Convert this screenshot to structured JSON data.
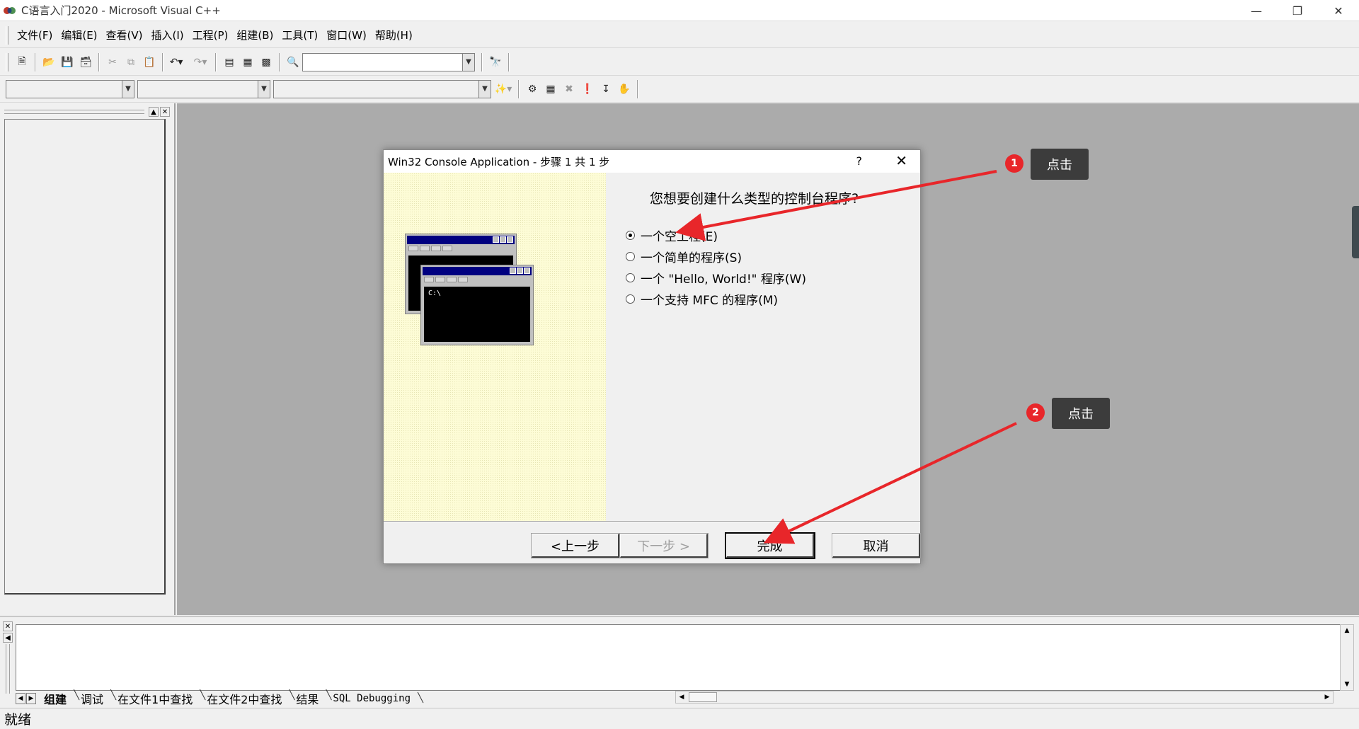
{
  "window": {
    "title": "C语言入门2020 - Microsoft Visual C++",
    "minimize_icon": "minimize-icon",
    "restore_icon": "restore-icon",
    "close_icon": "close-icon"
  },
  "menu": {
    "items": [
      "文件(F)",
      "编辑(E)",
      "查看(V)",
      "插入(I)",
      "工程(P)",
      "组建(B)",
      "工具(T)",
      "窗口(W)",
      "帮助(H)"
    ]
  },
  "toolbar": {
    "find_value": "",
    "class_combo": "",
    "filter_combo": "",
    "members_combo": ""
  },
  "dialog": {
    "title": "Win32 Console Application - 步骤 1 共 1 步",
    "help": "?",
    "question": "您想要创建什么类型的控制台程序?",
    "options": [
      {
        "label": "一个空工程(E)",
        "selected": true
      },
      {
        "label": "一个简单的程序(S)",
        "selected": false
      },
      {
        "label": "一个 \"Hello, World!\" 程序(W)",
        "selected": false
      },
      {
        "label": "一个支持 MFC 的程序(M)",
        "selected": false
      }
    ],
    "console_text": "C:\\",
    "buttons": {
      "back": "<上一步",
      "next": "下一步 >",
      "finish": "完成",
      "cancel": "取消"
    }
  },
  "annotations": [
    {
      "number": "1",
      "label": "点击"
    },
    {
      "number": "2",
      "label": "点击"
    }
  ],
  "annotation_color": "#e8262a",
  "output": {
    "tabs": [
      "组建",
      "调试",
      "在文件1中查找",
      "在文件2中查找",
      "结果",
      "SQL Debugging"
    ],
    "active_tab": "组建"
  },
  "status": {
    "text": "就绪"
  }
}
